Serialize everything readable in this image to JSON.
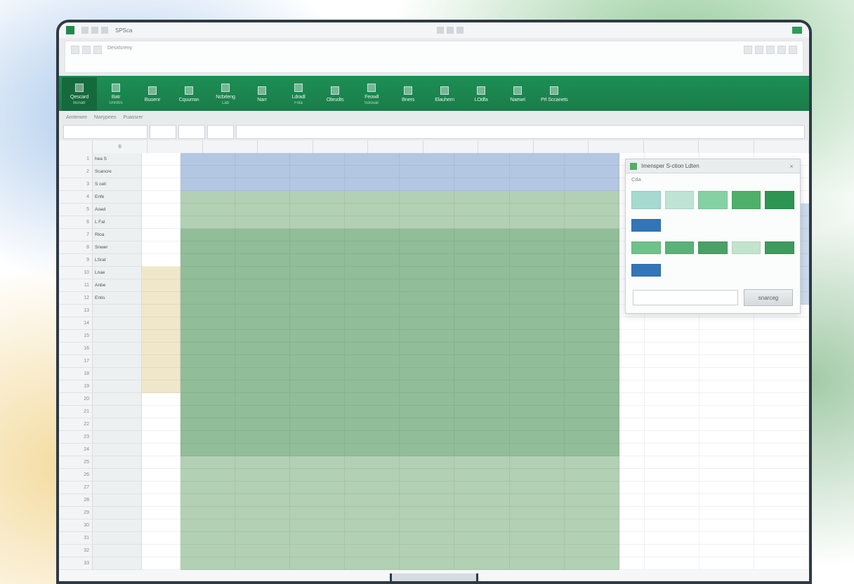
{
  "os": {
    "qat_title": "SPSca",
    "search_hint": "Desxtsreny"
  },
  "ribbon": {
    "tabs": [
      {
        "label": "Qescard",
        "sub": "Bunatr"
      },
      {
        "label": "Batr",
        "sub": "Unnttrs"
      },
      {
        "label": "Buoenr",
        "sub": ""
      },
      {
        "label": "Cquurran",
        "sub": ""
      },
      {
        "label": "Ncbrleng",
        "sub": "Lab"
      },
      {
        "label": "Narr",
        "sub": ""
      },
      {
        "label": "Ldradl",
        "sub": "Fola"
      },
      {
        "label": "Obrudts",
        "sub": ""
      },
      {
        "label": "Feowll",
        "sub": "Solouar"
      },
      {
        "label": "Bners",
        "sub": ""
      },
      {
        "label": "Elauhern",
        "sub": ""
      },
      {
        "label": "LOdfa",
        "sub": ""
      },
      {
        "label": "Naewri",
        "sub": ""
      },
      {
        "label": "Prl Sccanets",
        "sub": ""
      }
    ]
  },
  "toolbar": {
    "groups": [
      "Amterwre",
      "Nwrypeen",
      "Puassrer",
      "",
      "",
      "",
      "",
      ""
    ]
  },
  "columns": [
    "B",
    "",
    "",
    "",
    "",
    "",
    "",
    "",
    "",
    "",
    "",
    "",
    ""
  ],
  "row_labels": [
    "hea S",
    "Scancre",
    "S cell",
    "Enfe",
    "Aoad",
    "L Fal",
    "Rloa",
    "Snwer",
    "LSrat",
    "Lnae",
    "Anbe",
    "Entis",
    "",
    "",
    "",
    "",
    "",
    "",
    "",
    "",
    "",
    "",
    "",
    "",
    "",
    "",
    "",
    "",
    "",
    "",
    "",
    "",
    ""
  ],
  "pane": {
    "title": "Imensper S-ction Ldten",
    "subtitle": "Cda",
    "row1": [
      "#a6d9d0",
      "#bde4d5",
      "#86d1a4",
      "#4fb06a",
      "#2e9451"
    ],
    "row2": [
      "#3276b8",
      "",
      "",
      "",
      ""
    ],
    "row3": [
      "#70c28a",
      "#5cb178",
      "#4aa067",
      "#c2e4cc",
      "#3f9a5d"
    ],
    "row4": [
      "#3276b8",
      "",
      "",
      "",
      ""
    ],
    "button": "snarceg"
  }
}
